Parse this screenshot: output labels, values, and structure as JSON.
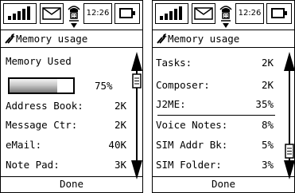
{
  "status": {
    "time": "12:26",
    "icons": [
      "signal-icon",
      "envelope-icon",
      "ringer-phone-icon",
      "battery-icon"
    ]
  },
  "left_screen": {
    "title": "Memory usage",
    "memory_used_label": "Memory Used",
    "memory_used_percent": "75%",
    "memory_used_fraction": 0.75,
    "items": [
      {
        "label": "Address Book:",
        "value": "2K"
      },
      {
        "label": "Message Ctr:",
        "value": "2K"
      },
      {
        "label": "eMail:",
        "value": "40K"
      },
      {
        "label": "Note Pad:",
        "value": "3K"
      }
    ],
    "done": "Done"
  },
  "right_screen": {
    "title": "Memory usage",
    "items": [
      {
        "label": "Tasks:",
        "value": "2K"
      },
      {
        "label": "Composer:",
        "value": "2K"
      },
      {
        "label": "J2ME:",
        "value": "35%"
      },
      {
        "label": "Voice Notes:",
        "value": "8%"
      },
      {
        "label": "SIM Addr Bk:",
        "value": "5%"
      },
      {
        "label": "SIM Folder:",
        "value": "3%"
      }
    ],
    "done": "Done"
  }
}
